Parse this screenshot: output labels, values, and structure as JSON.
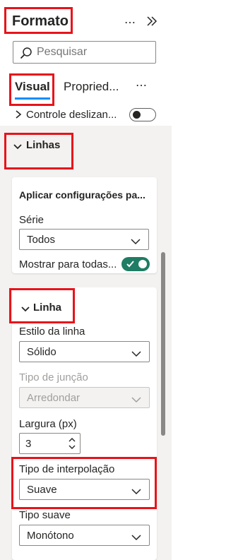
{
  "header": {
    "title": "Formato"
  },
  "search": {
    "placeholder": "Pesquisar"
  },
  "tabs": [
    {
      "label": "Visual"
    },
    {
      "label": "Propried..."
    }
  ],
  "previous_section": {
    "label": "Controle deslizan..."
  },
  "group": {
    "label": "Linhas"
  },
  "apply_card": {
    "title": "Aplicar configurações pa...",
    "series_label": "Série",
    "series_value": "Todos",
    "show_all_label": "Mostrar para todas..."
  },
  "line_card": {
    "title": "Linha",
    "style_label": "Estilo da linha",
    "style_value": "Sólido",
    "join_label": "Tipo de junção",
    "join_value": "Arredondar",
    "width_label": "Largura (px)",
    "width_value": "3",
    "interp_label": "Tipo de interpolação",
    "interp_value": "Suave",
    "smooth_label": "Tipo suave",
    "smooth_value": "Monótono"
  },
  "colors": {
    "accent": "#118DFF",
    "toggle_on": "#1e7d64",
    "annotation": "#e8131a",
    "panel_bg": "#f3f2f1"
  },
  "icons": [
    "more-icon",
    "collapse-panel-icon",
    "search-icon",
    "chevron-right-icon",
    "chevron-down-icon",
    "check-icon",
    "stepper-arrows-icon"
  ]
}
